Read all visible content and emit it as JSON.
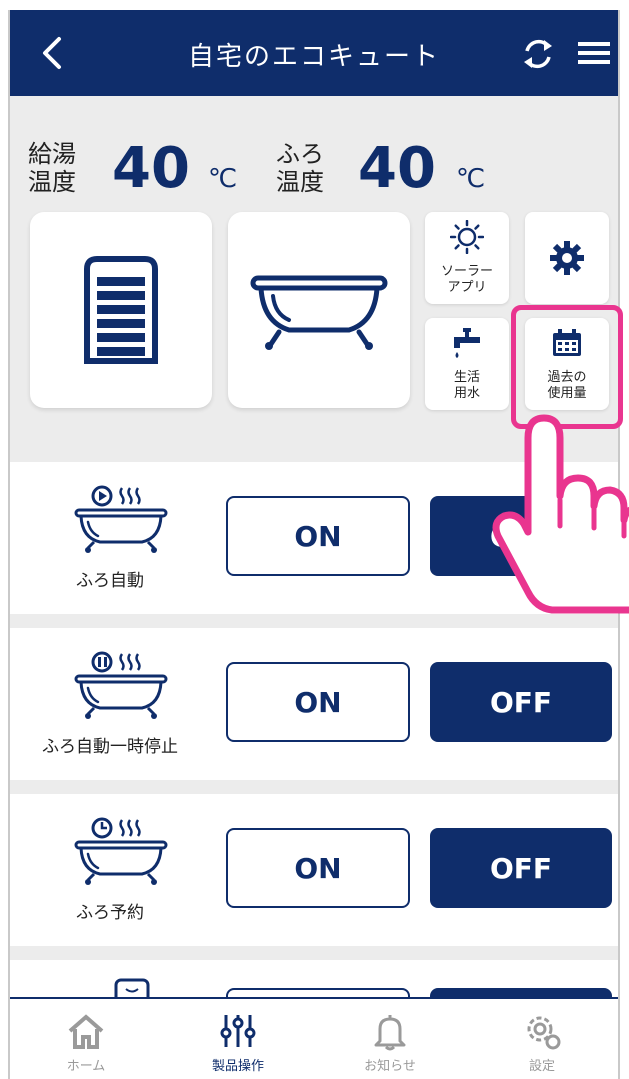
{
  "header": {
    "title": "自宅のエコキュート",
    "back_icon": "chevron-left-icon",
    "sync_icon": "sync-icon",
    "menu_icon": "hamburger-menu-icon",
    "bg_color": "#0f2d6b"
  },
  "temperatures": {
    "hot_water": {
      "label_line1": "給湯",
      "label_line2": "温度",
      "value": "40",
      "unit": "℃"
    },
    "bath": {
      "label_line1": "ふろ",
      "label_line2": "温度",
      "value": "40",
      "unit": "℃"
    }
  },
  "tiles": {
    "hot_water_tank_icon": "tank-level-icon",
    "bathtub_icon": "bathtub-icon",
    "solar_app": {
      "line1": "ソーラー",
      "line2": "アプリ",
      "icon": "sun-icon"
    },
    "settings_icon": "gear-icon",
    "living_water": {
      "line1": "生活",
      "line2": "用水",
      "icon": "faucet-icon"
    },
    "past_usage": {
      "line1": "過去の",
      "line2": "使用量",
      "icon": "calendar-icon"
    }
  },
  "rows": [
    {
      "name": "ふろ自動",
      "on_label": "ON",
      "off_label": "OFF",
      "icon": "bath-auto-play-icon"
    },
    {
      "name": "ふろ自動一時停止",
      "on_label": "ON",
      "off_label": "OFF",
      "icon": "bath-auto-pause-icon"
    },
    {
      "name": "ふろ予約",
      "on_label": "ON",
      "off_label": "OFF",
      "icon": "bath-reserve-clock-icon"
    }
  ],
  "tabs": [
    {
      "label": "ホーム",
      "icon": "home-icon",
      "active": false
    },
    {
      "label": "製品操作",
      "icon": "sliders-icon",
      "active": true
    },
    {
      "label": "お知らせ",
      "icon": "bell-icon",
      "active": false
    },
    {
      "label": "設定",
      "icon": "gear-icon",
      "active": false
    }
  ],
  "colors": {
    "primary": "#0f2d6b",
    "highlight": "#e9358f",
    "panel_bg": "#ececec"
  }
}
